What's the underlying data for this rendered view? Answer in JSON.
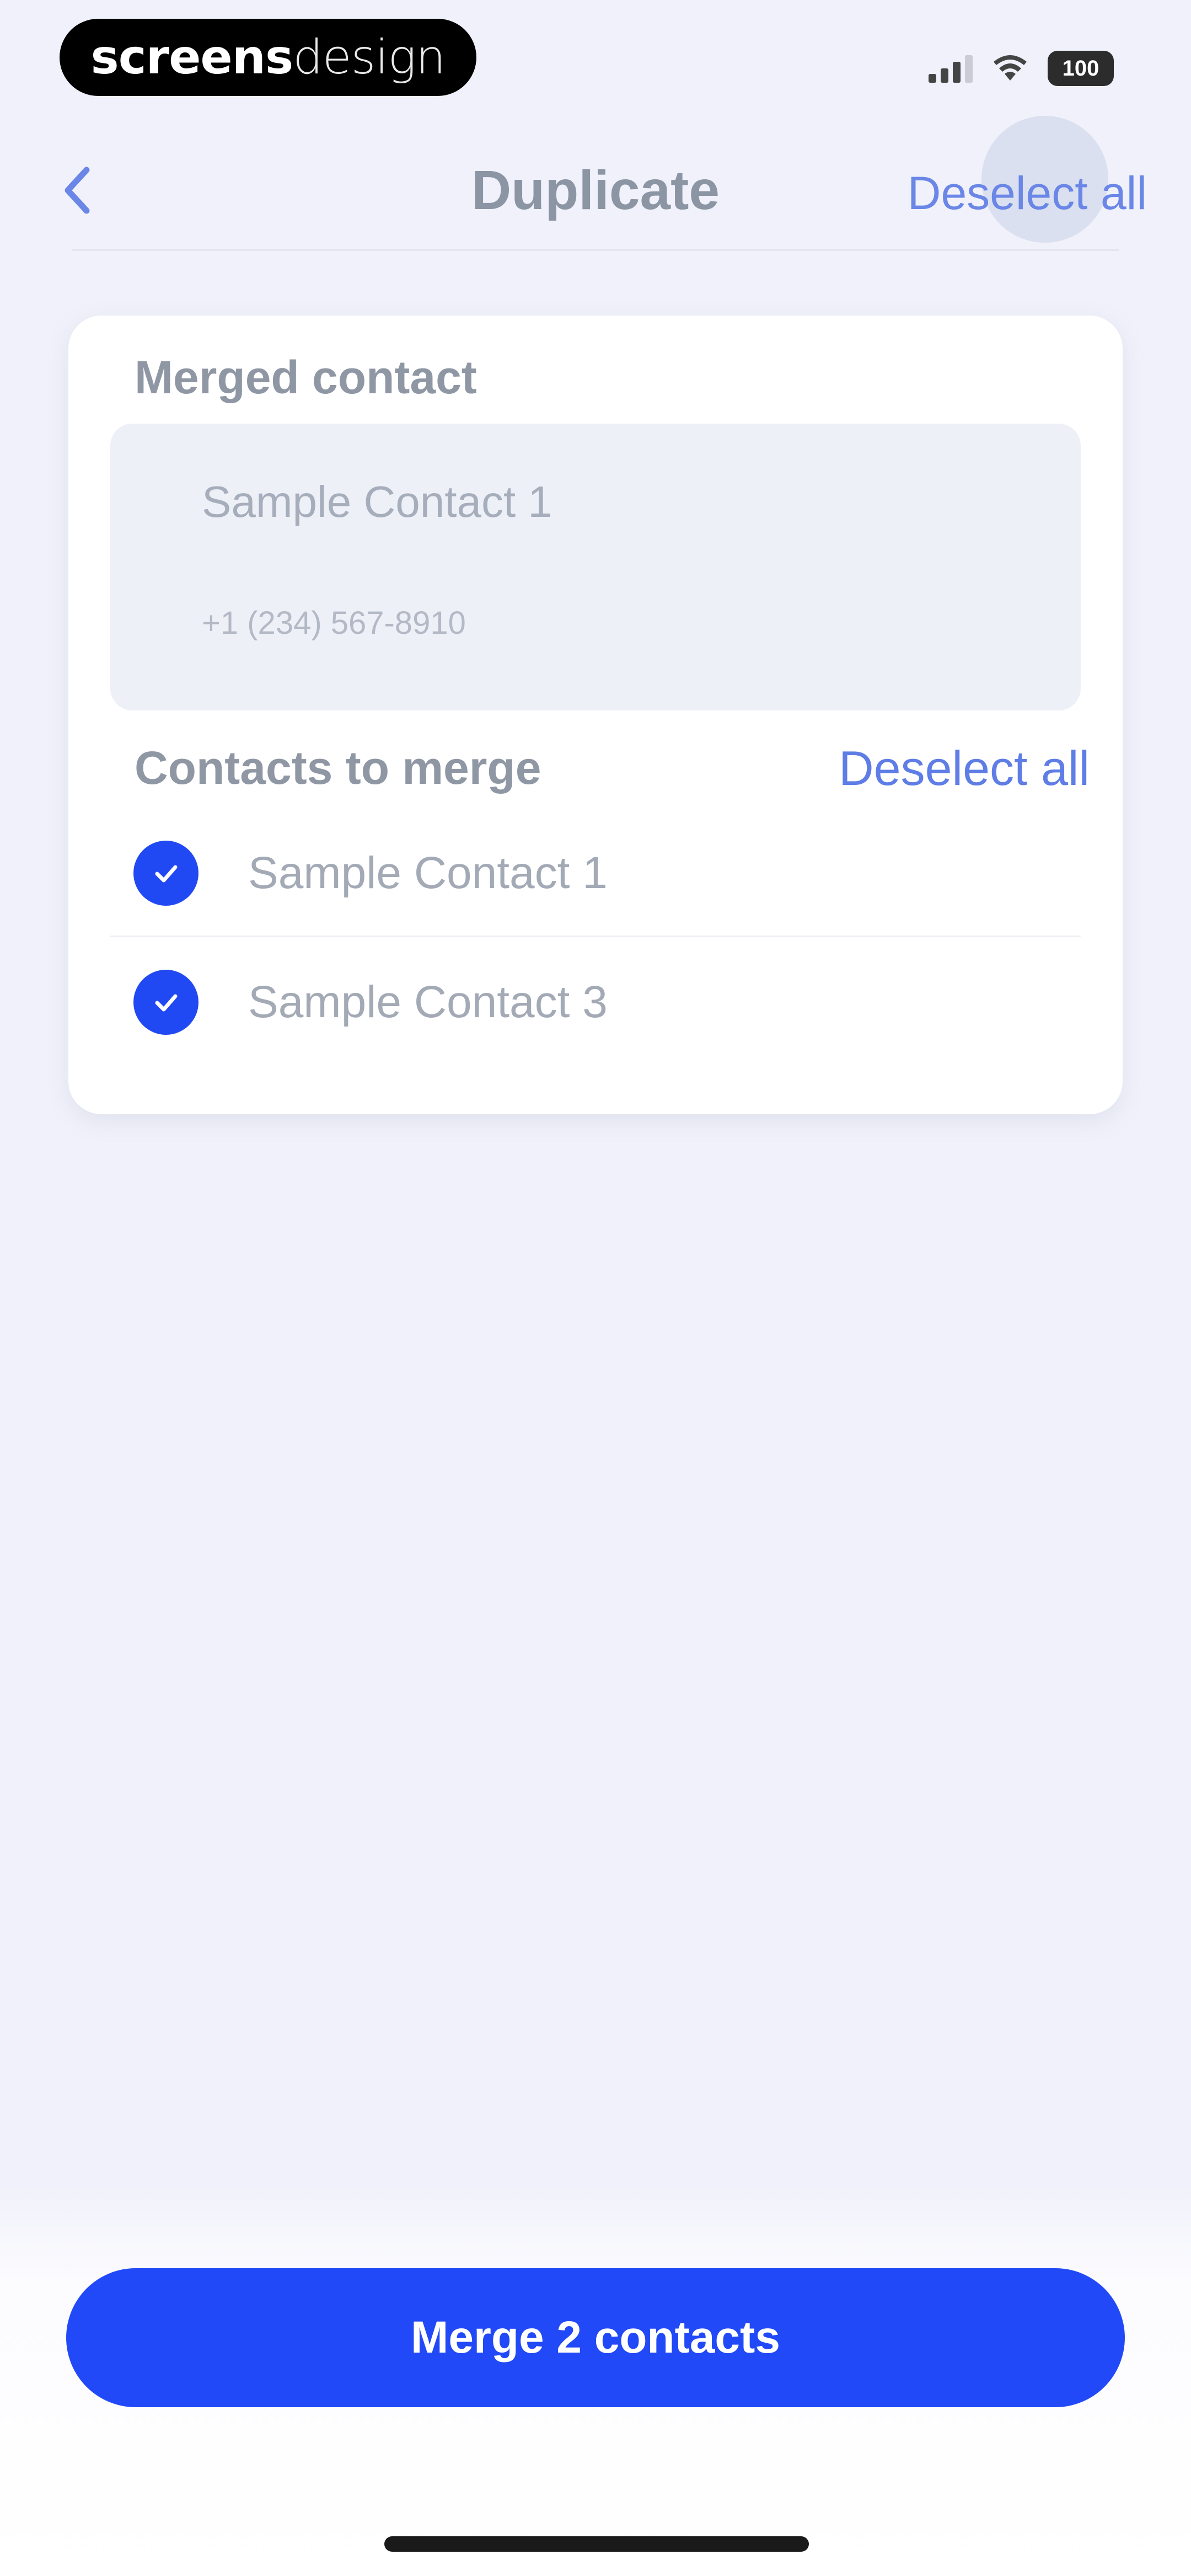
{
  "status_bar": {
    "watermark_part1": "screens",
    "watermark_part2": "design",
    "battery": "100"
  },
  "nav": {
    "title": "Duplicate",
    "deselect_label": "Deselect all"
  },
  "merged_contact": {
    "section_title": "Merged contact",
    "name": "Sample Contact 1",
    "phone": "+1 (234) 567-8910"
  },
  "contacts_to_merge": {
    "section_title": "Contacts to merge",
    "deselect_label": "Deselect all",
    "items": [
      {
        "name": "Sample Contact 1",
        "checked": true
      },
      {
        "name": "Sample Contact 3",
        "checked": true
      }
    ]
  },
  "merge_button_label": "Merge 2 contacts",
  "colors": {
    "accent": "#2149f7",
    "background": "#f0f1fa",
    "link": "#5f7de6"
  }
}
